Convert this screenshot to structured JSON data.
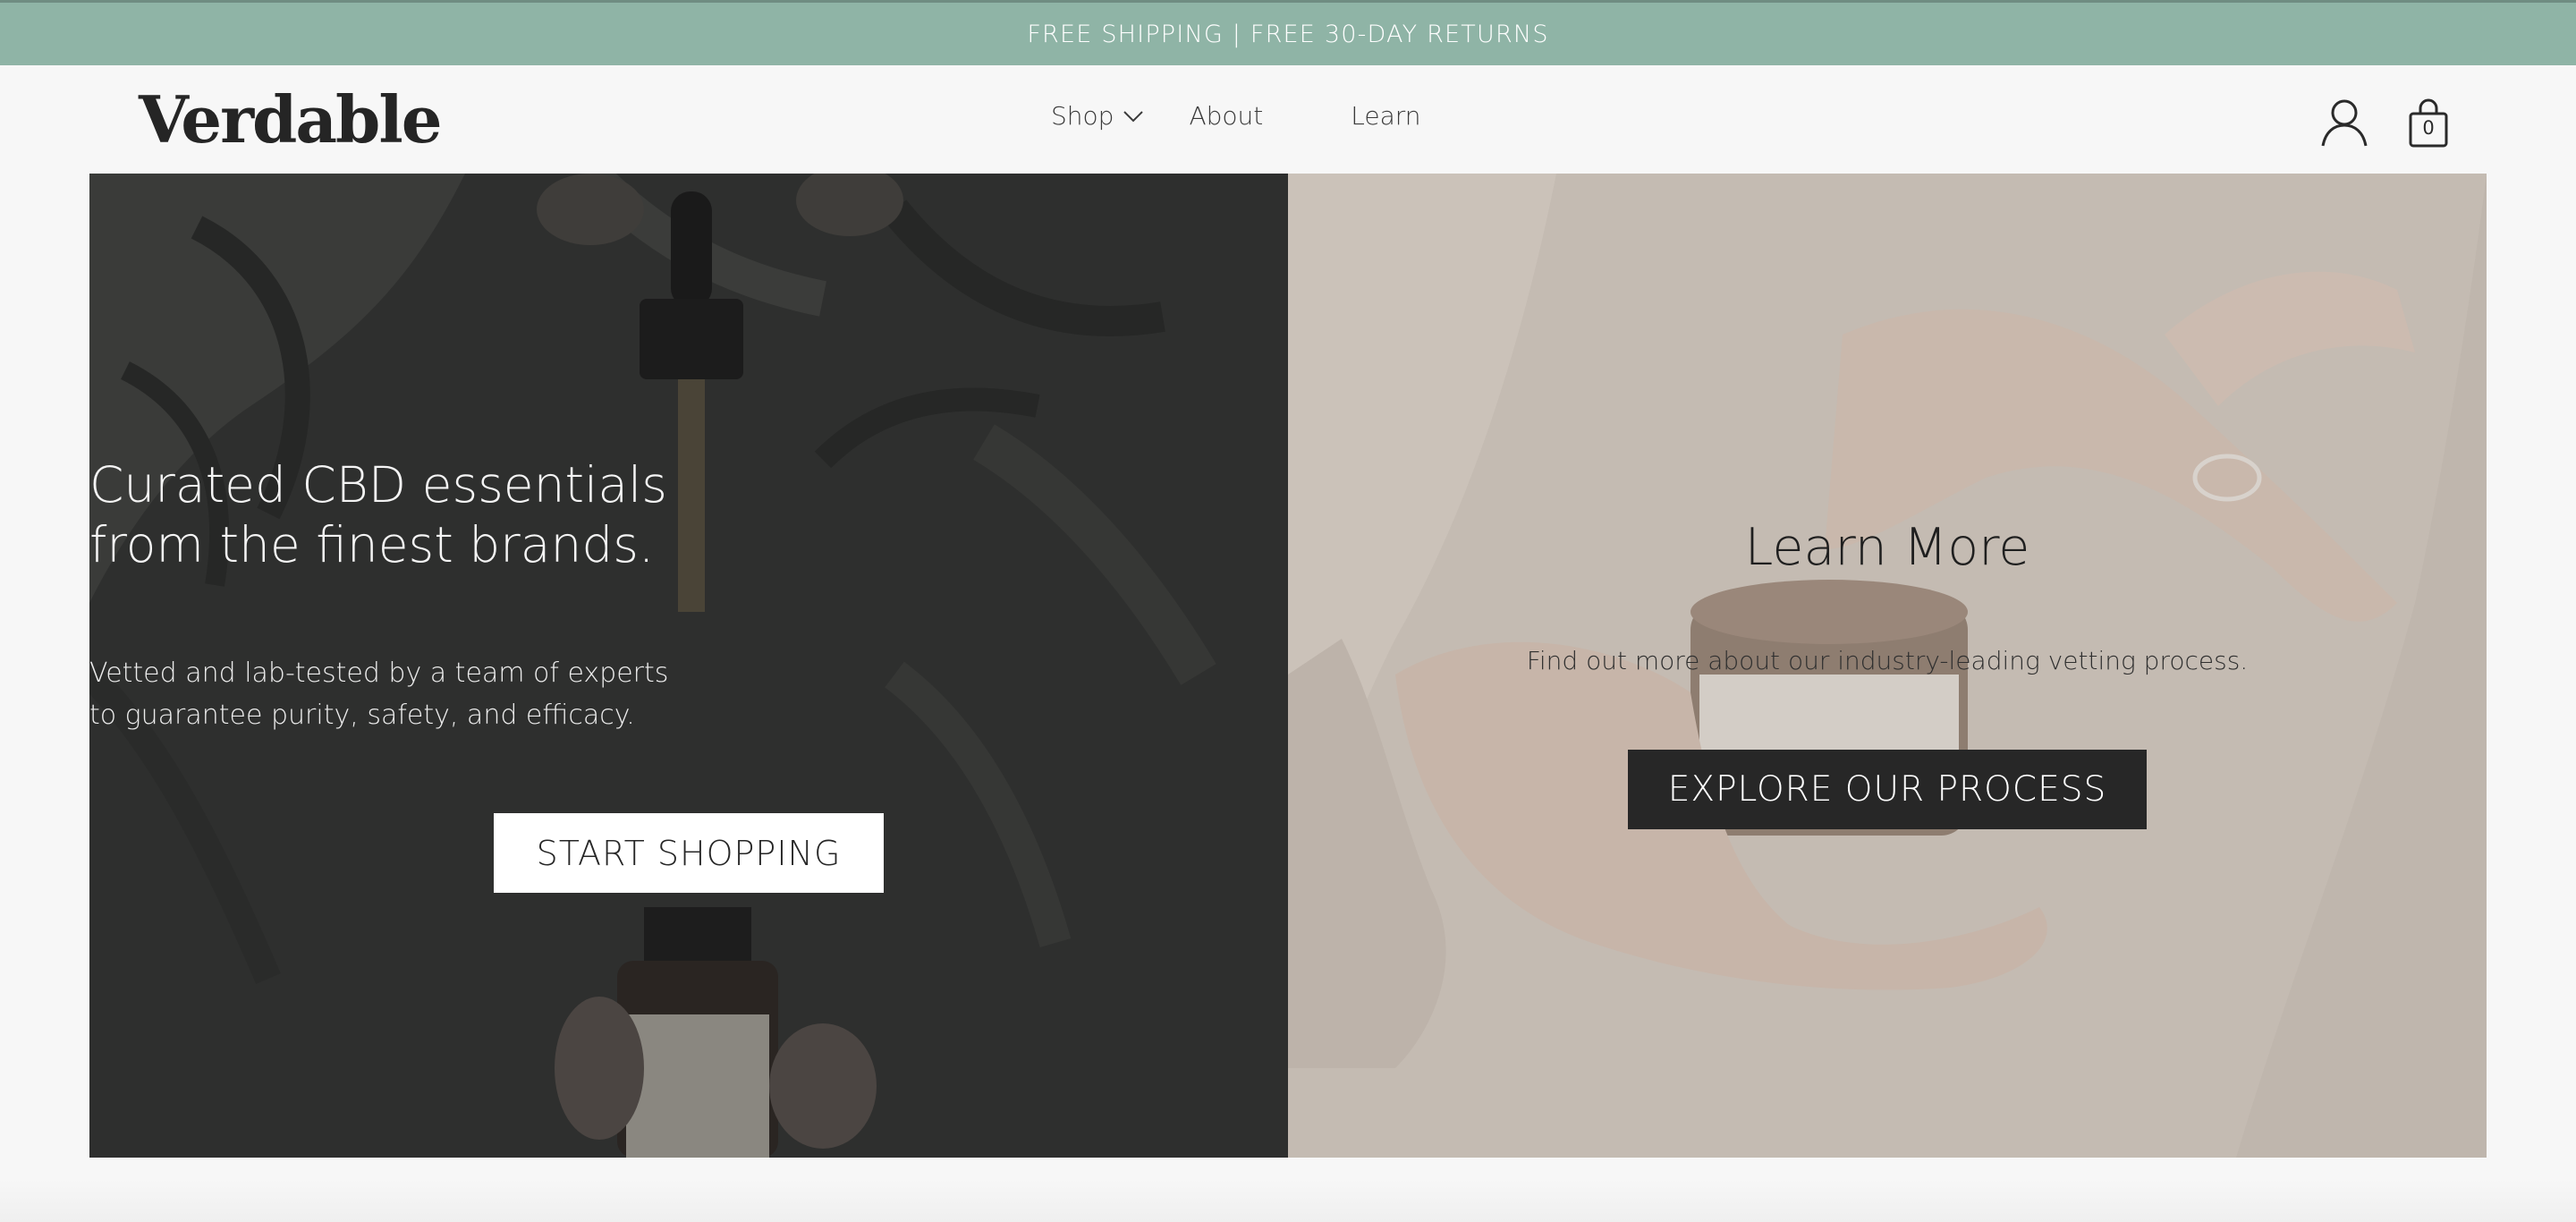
{
  "announcement": "FREE SHIPPING | FREE 30-DAY RETURNS",
  "brand": "Verdable",
  "nav": {
    "shop": "Shop",
    "about": "About",
    "learn": "Learn"
  },
  "cart": {
    "count": "0"
  },
  "hero_left": {
    "headline_line1": "Curated CBD essentials",
    "headline_line2": "from the finest brands.",
    "sub_line1": "Vetted and lab-tested by a team of experts",
    "sub_line2": "to guarantee purity, safety, and efficacy.",
    "button": "START SHOPPING"
  },
  "hero_right": {
    "headline": "Learn More",
    "sub": "Find out more about our industry-leading vetting process.",
    "button": "EXPLORE OUR PROCESS"
  },
  "colors": {
    "announcement_bg": "#8fb4a6",
    "left_overlay": "#2f302f",
    "right_overlay": "#c3bab1",
    "dark_button": "#272727"
  },
  "icons": [
    "chevron-down-icon",
    "user-icon",
    "shopping-bag-icon"
  ]
}
